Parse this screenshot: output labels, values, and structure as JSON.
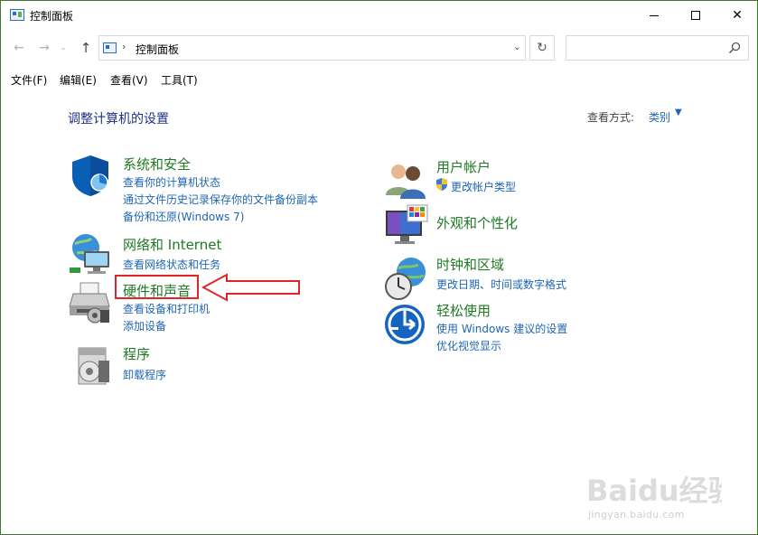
{
  "window": {
    "title": "控制面板",
    "controls": {
      "minimize": "—",
      "maximize": "☐",
      "close": "✕"
    }
  },
  "address": {
    "path": "控制面板",
    "separator": "›",
    "search_placeholder": ""
  },
  "menu": [
    "文件(F)",
    "编辑(E)",
    "查看(V)",
    "工具(T)"
  ],
  "main": {
    "title": "调整计算机的设置",
    "view_by_label": "查看方式:",
    "view_by_value": "类别"
  },
  "categories": [
    {
      "title": "系统和安全",
      "icon": "shield-icon",
      "links": [
        "查看你的计算机状态",
        "通过文件历史记录保存你的文件备份副本",
        "备份和还原(Windows 7)"
      ]
    },
    {
      "title": "网络和 Internet",
      "icon": "network-icon",
      "links": [
        "查看网络状态和任务"
      ]
    },
    {
      "title": "硬件和声音",
      "icon": "printer-icon",
      "links": [
        "查看设备和打印机",
        "添加设备"
      ]
    },
    {
      "title": "程序",
      "icon": "programs-icon",
      "links": [
        "卸载程序"
      ]
    },
    {
      "title": "用户帐户",
      "icon": "users-icon",
      "links": [
        "更改帐户类型"
      ]
    },
    {
      "title": "外观和个性化",
      "icon": "appearance-icon",
      "links": []
    },
    {
      "title": "时钟和区域",
      "icon": "clock-icon",
      "links": [
        "更改日期、时间或数字格式"
      ]
    },
    {
      "title": "轻松使用",
      "icon": "ease-of-access-icon",
      "links": [
        "使用 Windows 建议的设置",
        "优化视觉显示"
      ]
    }
  ],
  "watermark": {
    "logo": "Baidu经验",
    "url": "jingyan.baidu.com"
  },
  "colors": {
    "category_title": "#1e7a23",
    "link": "#1e66b4",
    "page_title": "#1e3287",
    "highlight": "#e0242a"
  }
}
